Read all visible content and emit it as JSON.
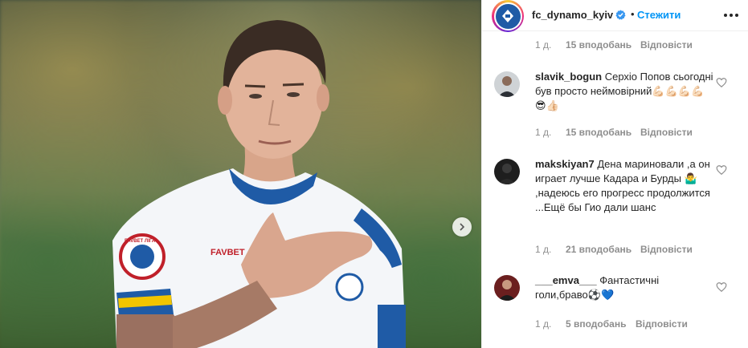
{
  "post": {
    "username": "fc_dynamo_kyiv",
    "follow_label": "Стежити",
    "dot": "•",
    "avatar_icon": "dynamo-kyiv-logo-icon",
    "verified_icon": "verified-badge-icon",
    "more_icon": "more-options-icon",
    "carousel_icon": "chevron-right-icon",
    "photo_description_icon": "player-photo"
  },
  "previous_comment": {
    "time": "1 д.",
    "likes": "15 вподобань",
    "reply": "Відповісти"
  },
  "comments": [
    {
      "username": "slavik_bogun",
      "text": "Серхіо Попов сьогодні був просто неймовірний💪🏻💪🏻💪🏻💪🏻😎👍🏻",
      "time": "1 д.",
      "likes": "15 вподобань",
      "reply": "Відповісти"
    },
    {
      "username": "makskiyan7",
      "text": "Дена мариновали ,а он играет лучше Кадара и Бурды 🤷‍♂️ ,надеюсь его прогресс продолжится ...Ещё бы Гио дали шанс",
      "time": "1 д.",
      "likes": "21 вподобань",
      "reply": "Відповісти"
    },
    {
      "username": "___emva___",
      "text": "Фантастичні голи,браво⚽💙",
      "time": "1 д.",
      "likes": "5 вподобань",
      "reply": "Відповісти"
    }
  ],
  "photo_text": {
    "sponsor": "FAVBET",
    "badge": "FAVBET ЛІГА"
  },
  "colors": {
    "accent": "#0095f6",
    "verified": "#3897f0",
    "muted": "#8e8e8e",
    "dynamo_blue": "#1f5ba6"
  }
}
